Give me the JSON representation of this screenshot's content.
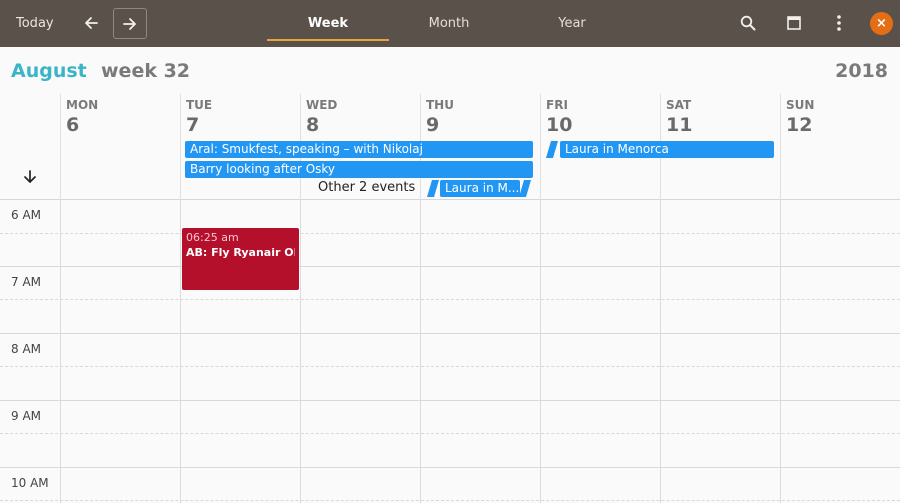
{
  "headerbar": {
    "today_label": "Today",
    "prev_icon": "arrow-left-icon",
    "next_icon": "arrow-right-icon",
    "tabs": [
      {
        "label": "Week",
        "active": true
      },
      {
        "label": "Month",
        "active": false
      },
      {
        "label": "Year",
        "active": false
      }
    ],
    "search_icon": "search-icon",
    "window_icon": "window-icon",
    "menu_icon": "kebab-menu-icon",
    "close_icon": "close-icon",
    "close_glyph": "×",
    "accent_color": "#e8a33b",
    "bar_color": "#5a514b",
    "close_color": "#e56e14"
  },
  "week_header": {
    "month": "August",
    "week": "week 32",
    "year": "2018",
    "month_color": "#3cb4c8"
  },
  "days": [
    {
      "name": "MON",
      "number": "6"
    },
    {
      "name": "TUE",
      "number": "7"
    },
    {
      "name": "WED",
      "number": "8"
    },
    {
      "name": "THU",
      "number": "9"
    },
    {
      "name": "FRI",
      "number": "10"
    },
    {
      "name": "SAT",
      "number": "11"
    },
    {
      "name": "SUN",
      "number": "12"
    }
  ],
  "all_day_events": [
    {
      "title": "Aral: Smukfest, speaking – with Nikolaj"
    },
    {
      "title": "Barry looking after Osky"
    },
    {
      "title": "Laura in Menorca"
    },
    {
      "title": "Laura in M..."
    }
  ],
  "other_events_label": "Other 2 events",
  "event_color": "#2196f3",
  "hours": [
    "6 AM",
    "7 AM",
    "8 AM",
    "9 AM",
    "10 AM"
  ],
  "timed_events": [
    {
      "time": "06:25 am",
      "title": "AB: Fly Ryanair OR...",
      "color": "#b5102b"
    }
  ]
}
